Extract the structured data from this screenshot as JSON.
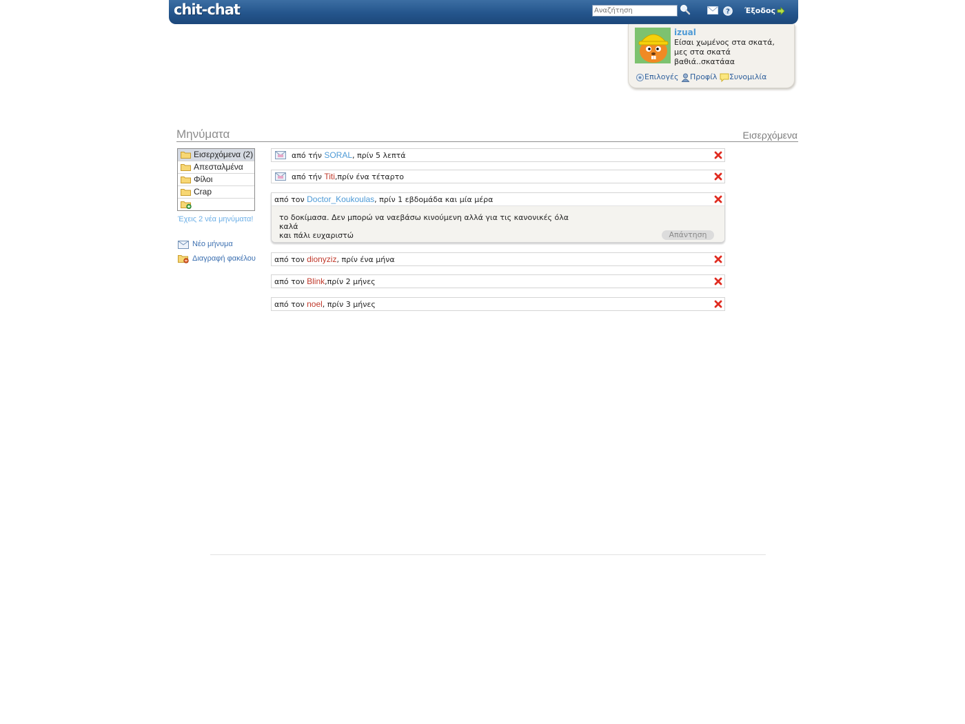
{
  "header": {
    "logo": "chit-chat",
    "search_placeholder": "Αναζήτηση",
    "logout_label": "Έξοδος"
  },
  "user_panel": {
    "username": "izual",
    "status": "Είσαι χωμένος στα σκατά, μες στα σκατά βαθιά..σκατάαα",
    "links": [
      "Επιλογές",
      "Προφίλ",
      "Συνομιλία"
    ]
  },
  "page": {
    "title": "Μηνύματα",
    "breadcrumb": "Εισερχόμενα"
  },
  "sidebar": {
    "folders": [
      {
        "label": "Εισερχόμενα (2)",
        "active": true
      },
      {
        "label": "Απεσταλμένα",
        "active": false
      },
      {
        "label": "Φίλοι",
        "active": false
      },
      {
        "label": "Crap",
        "active": false
      },
      {
        "label": "",
        "active": false
      }
    ],
    "new_messages_notice": "Έχεις 2 νέα μηνύματα!",
    "new_message_label": "Νέο μήνυμα",
    "delete_folder_label": "Διαγραφή φακέλου"
  },
  "messages": [
    {
      "prefix": "από τήν",
      "sender": "SORAL",
      "sender_color": "#4d9ad6",
      "suffix": ", πρίν 5 λεπτά",
      "unread": true
    },
    {
      "prefix": "από τήν",
      "sender": "Titi",
      "sender_color": "#c0392b",
      "suffix": ",πρίν ένα τέταρτο",
      "unread": true
    },
    {
      "prefix": "από τον",
      "sender": "Doctor_Koukoulas",
      "sender_color": "#4d9ad6",
      "suffix": ", πρίν 1 εβδομάδα και μία μέρα",
      "unread": false,
      "body_line1": "το δοκίμασα. Δεν μπορώ να ναεβάσω κινούμενη αλλά για τις κανονικές όλα καλά",
      "body_line2": "και πάλι ευχαριστώ",
      "reply_label": "Απάντηση"
    },
    {
      "prefix": "από τον",
      "sender": "dionyziz",
      "sender_color": "#c0392b",
      "suffix": ", πρίν ένα μήνα",
      "unread": false
    },
    {
      "prefix": "από τον",
      "sender": "Blink",
      "sender_color": "#c0392b",
      "suffix": ",πρίν 2 μήνες",
      "unread": false
    },
    {
      "prefix": "από τον",
      "sender": "noel",
      "sender_color": "#c0392b",
      "suffix": ", πρίν 3 μήνες",
      "unread": false
    }
  ]
}
